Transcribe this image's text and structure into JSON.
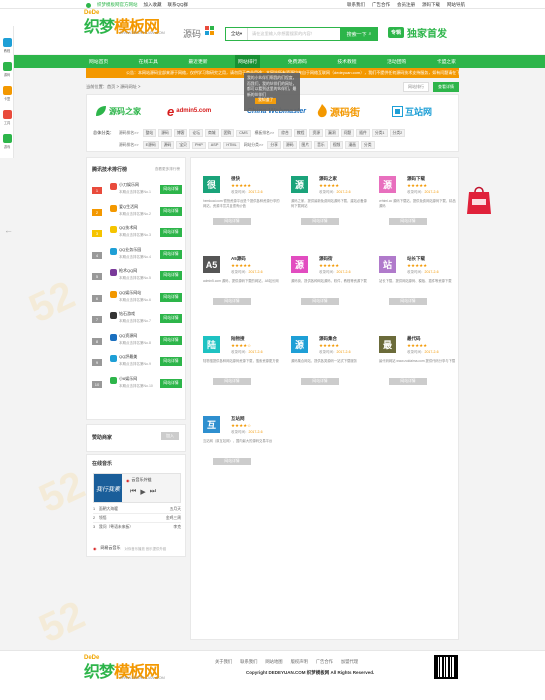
{
  "topbar": {
    "left_links": [
      "织梦模板网官方网站",
      "加入收藏",
      "联系QQ群"
    ],
    "right_links": [
      "联系我们",
      "广告合作",
      "会员注册",
      "源码下载",
      "网站导航"
    ]
  },
  "header": {
    "logo_prefix": "DeDe",
    "logo_main_1": "织梦",
    "logo_main_2": "模板网",
    "logo_url": "WWW.DEDEYUAN.COM",
    "yuanma_label": "源码",
    "search_scope": "全站",
    "search_placeholder": "请在这里输入你想要搜索的内容！",
    "search_button": "搜索一下",
    "promo_badge": "专辑",
    "promo_text": "独家首发"
  },
  "nav": [
    "网站首页",
    "在线工具",
    "最近更新",
    "网站排行",
    "免费源码",
    "技术教程",
    "活动团购",
    "卡盟之家"
  ],
  "notice": "公告：本网站源码全部来源于网络，仅供学习和研究之用，请勿用于商业用途；本网站所有资源均来自于网络互联网（dedeyuan.com），我们不提供任何源码技术支持服务，如有问题请在下载本站源码的页面评论区留言",
  "breadcrumb": "当前位置：首页 > 源码网址 >",
  "breadcrumb_buttons": [
    "网站排行",
    "查看详情"
  ],
  "tooltip": {
    "text": "我的小伙伴们啊我的们程度，而我们，我的伙伴们的网址，都可以看到这里的伙伴们，最新的伙伴们",
    "button": "我知道了"
  },
  "brands": [
    {
      "name": "源码之家",
      "color": "#2db54a"
    },
    {
      "name": "admin5.com",
      "color": "#d61a1a"
    },
    {
      "name": "China Webmaster",
      "color": "#1a6fbf"
    },
    {
      "name": "源码街",
      "color": "#f39800"
    },
    {
      "name": "互站网",
      "color": "#1e9fd6"
    }
  ],
  "filters": [
    {
      "label": "总体分类：",
      "groups": [
        {
          "sub": "源码排名>>",
          "chips": [
            "整站",
            "源码",
            "博客",
            "论坛",
            "商城",
            "团购",
            "CMS"
          ]
        },
        {
          "sub": "模板排名>>",
          "chips": [
            "综合",
            "教程",
            "资源",
            "漏洞",
            "问题",
            "插件"
          ]
        },
        {
          "sub": "",
          "chips": [
            "分类1",
            "分类2"
          ]
        }
      ]
    },
    {
      "label": "",
      "groups": [
        {
          "sub": "源码排名>>",
          "chips": [
            "E源码",
            "源码",
            "宝贝",
            "PHP",
            "ASP",
            "HTML"
          ]
        },
        {
          "sub": "网站分类>>",
          "chips": [
            "分享",
            "源码",
            "图片",
            "音乐",
            "视频",
            "漫画"
          ]
        },
        {
          "sub": "",
          "chips": [
            "分类"
          ]
        }
      ]
    }
  ],
  "ranking": {
    "title": "腾讯技术排行榜",
    "more": "查看更多排行榜",
    "button_label": "网站详情",
    "items": [
      {
        "num": "1",
        "name": "小刀娱乐网",
        "sub": "本期点击排名第No.1",
        "icon": "#e94b3c",
        "numcolor": "#e94b3c"
      },
      {
        "num": "2",
        "name": "爱Q生活网",
        "sub": "本期点击排名第No.2",
        "icon": "#f39800",
        "numcolor": "#f39800"
      },
      {
        "num": "3",
        "name": "QQ技术网",
        "sub": "本期点击排名第No.3",
        "icon": "#f5c400",
        "numcolor": "#f5c400"
      },
      {
        "num": "4",
        "name": "QQ业务乐园",
        "sub": "本期点击排名第No.4",
        "icon": "#1e9fd6",
        "numcolor": "#999"
      },
      {
        "num": "5",
        "name": "枪术QQ网",
        "sub": "本期点击排名第No.5",
        "icon": "#7a3a9a",
        "numcolor": "#999"
      },
      {
        "num": "6",
        "name": "QQ娱乐网站",
        "sub": "本期点击排名第No.6",
        "icon": "#f39800",
        "numcolor": "#999"
      },
      {
        "num": "7",
        "name": "钻石游戏",
        "sub": "本期点击排名第No.7",
        "icon": "#333333",
        "numcolor": "#999"
      },
      {
        "num": "8",
        "name": "QQ资源网",
        "sub": "本期点击排名第No.8",
        "icon": "#1a6fbf",
        "numcolor": "#999"
      },
      {
        "num": "9",
        "name": "QQ評最美",
        "sub": "本期点击排名第No.9",
        "icon": "#1e9fd6",
        "numcolor": "#999"
      },
      {
        "num": "10",
        "name": "小6娱乐网",
        "sub": "本期点击排名第No.10",
        "icon": "#2db54a",
        "numcolor": "#999"
      }
    ]
  },
  "partner": {
    "title": "赞助商家",
    "button": "加入"
  },
  "music": {
    "title": "在线音乐",
    "cover_text": "我行我素",
    "player_name": "云音乐外链",
    "songs": [
      {
        "n": "1",
        "title": "面朝大海暖",
        "artist": "五月天"
      },
      {
        "n": "2",
        "title": "领悟",
        "artist": "金鸡三周"
      },
      {
        "n": "3",
        "title": "我问（粤语未来板）",
        "artist": "李克"
      }
    ],
    "footer_brand": "网易云音乐",
    "footer_note": "对你音乐播放 音乐提供外链"
  },
  "cards_button": "网站详情",
  "cards": [
    {
      "icon": "很",
      "name": "很快",
      "stars": "★★★★★",
      "label": "收录时间：",
      "date": "2017-2-6",
      "desc": "hemkuai.com 很快资源平台是个提供各种资源分享的网站，资源丰富并且很有价值",
      "color": "#1aa37a"
    },
    {
      "icon": "源",
      "name": "源码之家",
      "stars": "★★★★★",
      "label": "收录时间：",
      "date": "2017-2-6",
      "desc": "源码之家，提供最新免费网站源码下载，建站必备源码下载网站",
      "color": "#1aa37a"
    },
    {
      "icon": "源",
      "name": "源码下载",
      "stars": "★★★★★",
      "label": "收录时间：",
      "date": "2017-2-6",
      "desc": "vrhtml.cc 源码下载站，提供免费网站源码下载，精品源码",
      "color": "#e86fbe"
    },
    {
      "icon": "A5",
      "name": "A5源码",
      "stars": "★★★★★",
      "label": "收录时间：",
      "date": "2017-2-6",
      "desc": "admin5.com 源码，提供源码下载的网站，A5站长网",
      "color": "#555555"
    },
    {
      "icon": "源",
      "name": "源码街",
      "stars": "★★★★★",
      "label": "收录时间：",
      "date": "2017-2-6",
      "desc": "源码街，提供各种网站源码，软件，教程等资源下载",
      "color": "#e24cc0"
    },
    {
      "icon": "站",
      "name": "站长下载",
      "stars": "★★★★★",
      "label": "收录时间：",
      "date": "2017-2-6",
      "desc": "站长下载，提供网站源码、模板、插件等资源下载",
      "color": "#b07acb"
    },
    {
      "icon": "陆",
      "name": "陆物搜",
      "stars": "★★★★☆",
      "label": "收录时间：",
      "date": "2017-2-6",
      "desc": "陆物搜提供各种网站源码资源下载，搜索资源更方便",
      "color": "#1ec2c2"
    },
    {
      "icon": "源",
      "name": "源码集合",
      "stars": "★★★★★",
      "label": "收录时间：",
      "date": "2017-2-6",
      "desc": "源码集合网站，提供各类源码一站式下载服务",
      "color": "#1e9fd6"
    },
    {
      "icon": "最",
      "name": "最代码",
      "stars": "★★★★★",
      "label": "收录时间：",
      "date": "2017-2-6",
      "desc": "最代码网站 www.zuidaima.com 提供代码分享与下载",
      "color": "#6b6b3a"
    },
    {
      "icon": "互",
      "name": "互站网",
      "stars": "★★★★☆",
      "label": "收录时间：",
      "date": "2017-2-6",
      "desc": "互站网（原互站网），国内最大的源码交易平台",
      "color": "#2e8fcf"
    }
  ],
  "footer": {
    "logo_prefix": "DeDe",
    "logo_main_1": "织梦",
    "logo_main_2": "模板网",
    "logo_url": "WWW.DEDEYUAN.COM",
    "links": [
      "关于我们",
      "联系我们",
      "网站地图",
      "版权声明",
      "广告合作",
      "加盟代理"
    ],
    "copyright": "Copyright DEDEYUAN.COM 织梦模板网 All Rights Reserved."
  },
  "sidebar": [
    {
      "label": "教程",
      "color": "#1e9fd6"
    },
    {
      "label": "源码",
      "color": "#2db54a"
    },
    {
      "label": "卡盟",
      "color": "#f39800"
    },
    {
      "label": "工具",
      "color": "#e94b3c"
    },
    {
      "label": "游戏",
      "color": "#2db54a"
    }
  ],
  "watermark": "52"
}
